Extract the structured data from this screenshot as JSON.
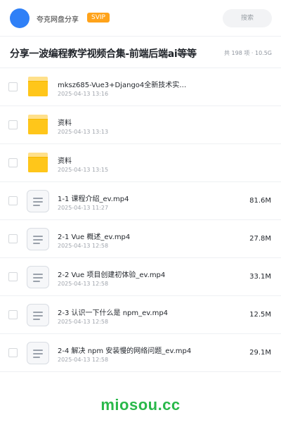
{
  "header": {
    "brand": "夸克网盘分享",
    "badge": "SVIP",
    "search_label": "搜索"
  },
  "share": {
    "title": "分享一波编程教学视频合集-前端后端ai等等",
    "count_text": "共 198 项 · 10.5G"
  },
  "files": [
    {
      "type": "folder",
      "name": "mksz685-Vue3+Django4全新技术实…",
      "date": "2025-04-13 13:16",
      "size": ""
    },
    {
      "type": "folder",
      "name": "资料",
      "date": "2025-04-13 13:13",
      "size": ""
    },
    {
      "type": "folder",
      "name": "资料",
      "date": "2025-04-13 13:15",
      "size": ""
    },
    {
      "type": "file",
      "name": "1-1 课程介绍_ev.mp4",
      "date": "2025-04-13 11:27",
      "size": "81.6M"
    },
    {
      "type": "file",
      "name": "2-1 Vue 概述_ev.mp4",
      "date": "2025-04-13 12:58",
      "size": "27.8M"
    },
    {
      "type": "file",
      "name": "2-2 Vue 项目创建初体验_ev.mp4",
      "date": "2025-04-13 12:58",
      "size": "33.1M"
    },
    {
      "type": "file",
      "name": "2-3 认识一下什么是 npm_ev.mp4",
      "date": "2025-04-13 12:58",
      "size": "12.5M"
    },
    {
      "type": "file",
      "name": "2-4 解决 npm 安装慢的网络问题_ev.mp4",
      "date": "2025-04-13 12:58",
      "size": "29.1M"
    }
  ],
  "watermark": "miosou.cc",
  "icons": {
    "folder": "folder-icon",
    "file": "document-icon"
  },
  "colors": {
    "avatar": "#2f80f7",
    "badge": "#ffa31a",
    "folder": "#ffc61a",
    "watermark": "#29b84a"
  }
}
